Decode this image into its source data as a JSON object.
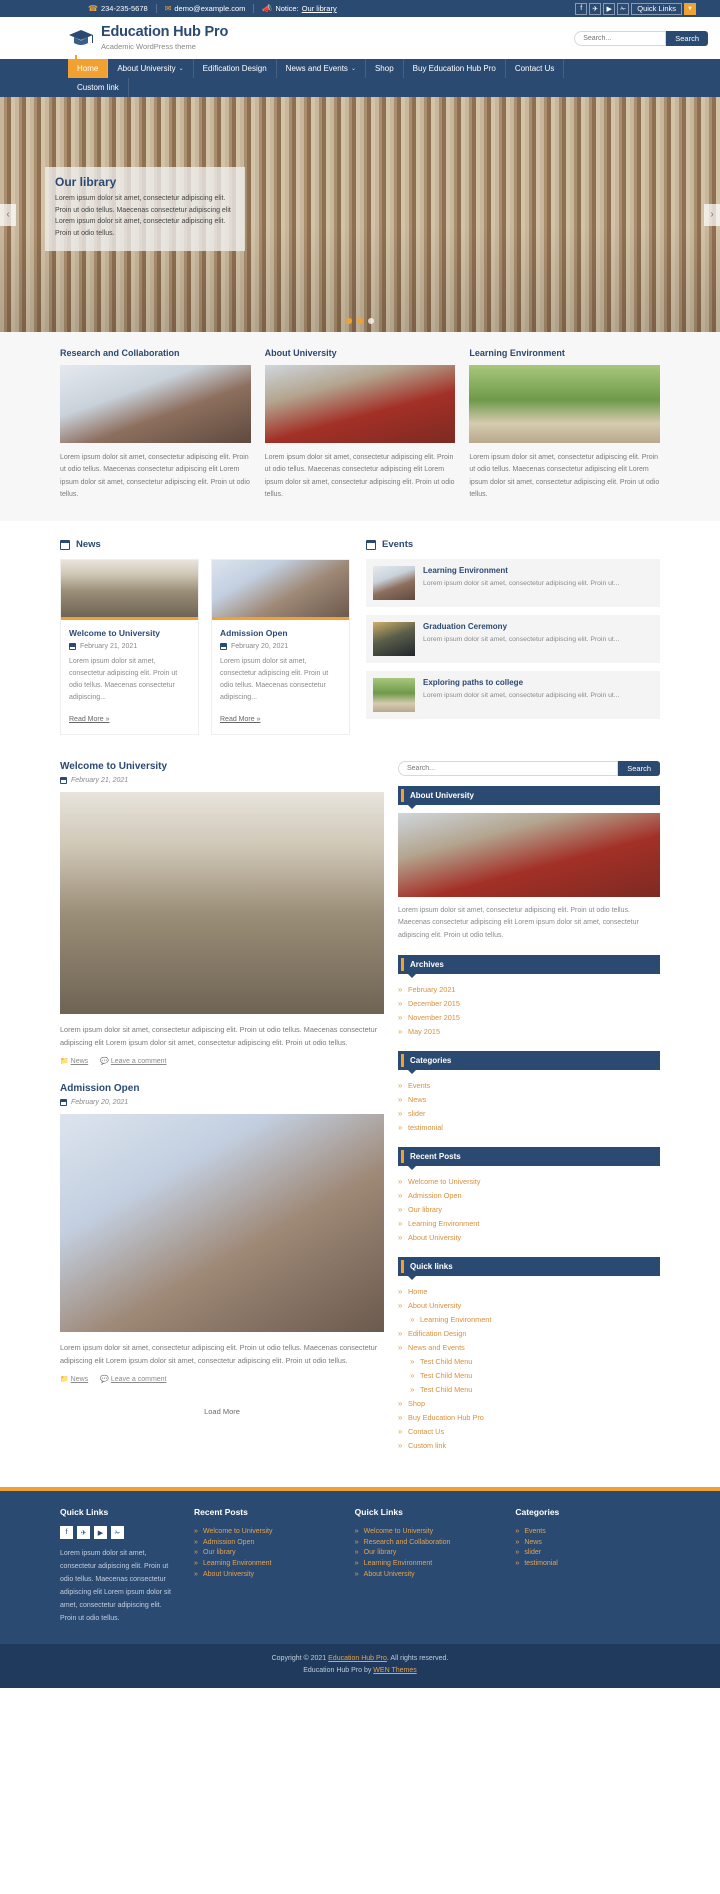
{
  "topbar": {
    "phone": "234-235-5678",
    "email": "demo@example.com",
    "notice_label": "Notice:",
    "notice_link": "Our library",
    "social": [
      {
        "name": "facebook-icon",
        "glyph": "f"
      },
      {
        "name": "twitter-icon",
        "glyph": "✈"
      },
      {
        "name": "youtube-icon",
        "glyph": "▶"
      },
      {
        "name": "link-icon",
        "glyph": "✁"
      }
    ],
    "quicklinks_label": "Quick Links",
    "caret": "▼"
  },
  "header": {
    "site_title": "Education Hub Pro",
    "tagline": "Academic WordPress theme",
    "search_placeholder": "Search...",
    "search_button": "Search"
  },
  "nav": {
    "items": [
      {
        "label": "Home",
        "active": true,
        "caret": ""
      },
      {
        "label": "About University",
        "active": false,
        "caret": "⌄"
      },
      {
        "label": "Edification Design",
        "active": false,
        "caret": ""
      },
      {
        "label": "News and Events",
        "active": false,
        "caret": "⌄"
      },
      {
        "label": "Shop",
        "active": false,
        "caret": ""
      },
      {
        "label": "Buy Education Hub Pro",
        "active": false,
        "caret": ""
      },
      {
        "label": "Contact Us",
        "active": false,
        "caret": ""
      }
    ],
    "row2": [
      {
        "label": "Custom link",
        "active": false,
        "caret": ""
      }
    ]
  },
  "slider": {
    "caption_title": "Our library",
    "caption_text": "Lorem ipsum dolor sit amet, consectetur adipiscing elit. Proin ut odio tellus. Maecenas consectetur adipiscing elit Lorem ipsum dolor sit amet, consectetur adipiscing elit. Proin ut odio tellus.",
    "prev": "‹",
    "next": "›",
    "dots": 3,
    "active_dot": 1
  },
  "features": [
    {
      "title": "Research and Collaboration",
      "text": "Lorem ipsum dolor sit amet, consectetur adipiscing elit. Proin ut odio tellus. Maecenas consectetur adipiscing elit Lorem ipsum dolor sit amet, consectetur adipiscing elit. Proin ut odio tellus."
    },
    {
      "title": "About University",
      "text": "Lorem ipsum dolor sit amet, consectetur adipiscing elit. Proin ut odio tellus. Maecenas consectetur adipiscing elit Lorem ipsum dolor sit amet, consectetur adipiscing elit. Proin ut odio tellus."
    },
    {
      "title": "Learning Environment",
      "text": "Lorem ipsum dolor sit amet, consectetur adipiscing elit. Proin ut odio tellus. Maecenas consectetur adipiscing elit Lorem ipsum dolor sit amet, consectetur adipiscing elit. Proin ut odio tellus."
    }
  ],
  "news": {
    "heading": "News",
    "cards": [
      {
        "title": "Welcome to University",
        "date": "February 21, 2021",
        "excerpt": "Lorem ipsum dolor sit amet, consectetur adipiscing elit. Proin ut odio tellus. Maecenas consectetur adipiscing...",
        "readmore": "Read More »"
      },
      {
        "title": "Admission Open",
        "date": "February 20, 2021",
        "excerpt": "Lorem ipsum dolor sit amet, consectetur adipiscing elit. Proin ut odio tellus. Maecenas consectetur adipiscing...",
        "readmore": "Read More »"
      }
    ]
  },
  "events": {
    "heading": "Events",
    "items": [
      {
        "title": "Learning Environment",
        "text": "Lorem ipsum dolor sit amet, consectetur adipiscing elit. Proin ut..."
      },
      {
        "title": "Graduation Ceremony",
        "text": "Lorem ipsum dolor sit amet, consectetur adipiscing elit. Proin ut..."
      },
      {
        "title": "Exploring paths to college",
        "text": "Lorem ipsum dolor sit amet, consectetur adipiscing elit. Proin ut..."
      }
    ]
  },
  "posts": [
    {
      "title": "Welcome to University",
      "date": "February 21, 2021",
      "excerpt": "Lorem ipsum dolor sit amet, consectetur adipiscing elit. Proin ut odio tellus. Maecenas consectetur adipiscing elit Lorem ipsum dolor sit amet, consectetur adipiscing elit. Proin ut odio tellus.",
      "category": "News",
      "comments": "Leave a comment"
    },
    {
      "title": "Admission Open",
      "date": "February 20, 2021",
      "excerpt": "Lorem ipsum dolor sit amet, consectetur adipiscing elit. Proin ut odio tellus. Maecenas consectetur adipiscing elit Lorem ipsum dolor sit amet, consectetur adipiscing elit. Proin ut odio tellus.",
      "category": "News",
      "comments": "Leave a comment"
    }
  ],
  "load_more": "Load More",
  "sidebar": {
    "search_placeholder": "Search...",
    "search_button": "Search",
    "about": {
      "title": "About University",
      "text": "Lorem ipsum dolor sit amet, consectetur adipiscing elit. Proin ut odio tellus. Maecenas consectetur adipiscing elit Lorem ipsum dolor sit amet, consectetur adipiscing elit. Proin ut odio tellus."
    },
    "archives": {
      "title": "Archives",
      "items": [
        "February 2021",
        "December 2015",
        "November 2015",
        "May 2015"
      ]
    },
    "categories": {
      "title": "Categories",
      "items": [
        "Events",
        "News",
        "slider",
        "testimonial"
      ]
    },
    "recent_posts": {
      "title": "Recent Posts",
      "items": [
        "Welcome to University",
        "Admission Open",
        "Our library",
        "Learning Environment",
        "About University"
      ]
    },
    "quick_links": {
      "title": "Quick links",
      "items": [
        {
          "label": "Home",
          "sub": false
        },
        {
          "label": "About University",
          "sub": false
        },
        {
          "label": "Learning Environment",
          "sub": true
        },
        {
          "label": "Edification Design",
          "sub": false
        },
        {
          "label": "News and Events",
          "sub": false
        },
        {
          "label": "Test Child Menu",
          "sub": true
        },
        {
          "label": "Test Child Menu",
          "sub": true
        },
        {
          "label": "Test Child Menu",
          "sub": true
        },
        {
          "label": "Shop",
          "sub": false
        },
        {
          "label": "Buy Education Hub Pro",
          "sub": false
        },
        {
          "label": "Contact Us",
          "sub": false
        },
        {
          "label": "Custom link",
          "sub": false
        }
      ]
    }
  },
  "footer": {
    "col1": {
      "title": "Quick Links",
      "social": [
        {
          "name": "facebook-icon",
          "glyph": "f"
        },
        {
          "name": "twitter-icon",
          "glyph": "✈"
        },
        {
          "name": "youtube-icon",
          "glyph": "▶"
        },
        {
          "name": "link-icon",
          "glyph": "✁"
        }
      ],
      "text": "Lorem ipsum dolor sit amet, consectetur adipiscing elit. Proin ut odio tellus. Maecenas consectetur adipiscing elit Lorem ipsum dolor sit amet, consectetur adipiscing elit. Proin ut odio tellus."
    },
    "col2": {
      "title": "Recent Posts",
      "items": [
        "Welcome to University",
        "Admission Open",
        "Our library",
        "Learning Environment",
        "About University"
      ]
    },
    "col3": {
      "title": "Quick Links",
      "items": [
        "Welcome to University",
        "Research and Collaboration",
        "Our library",
        "Learning Environment",
        "About University"
      ]
    },
    "col4": {
      "title": "Categories",
      "items": [
        "Events",
        "News",
        "slider",
        "testimonial"
      ]
    },
    "copyright_prefix": "Copyright © 2021 ",
    "copyright_link": "Education Hub Pro",
    "copyright_suffix": ". All rights reserved.",
    "credit_prefix": "Education Hub Pro by ",
    "credit_link": "WEN Themes"
  },
  "colors": {
    "brand_blue": "#2b4a72",
    "accent_orange": "#f0a132",
    "footer_dark": "#1f3a5c"
  }
}
